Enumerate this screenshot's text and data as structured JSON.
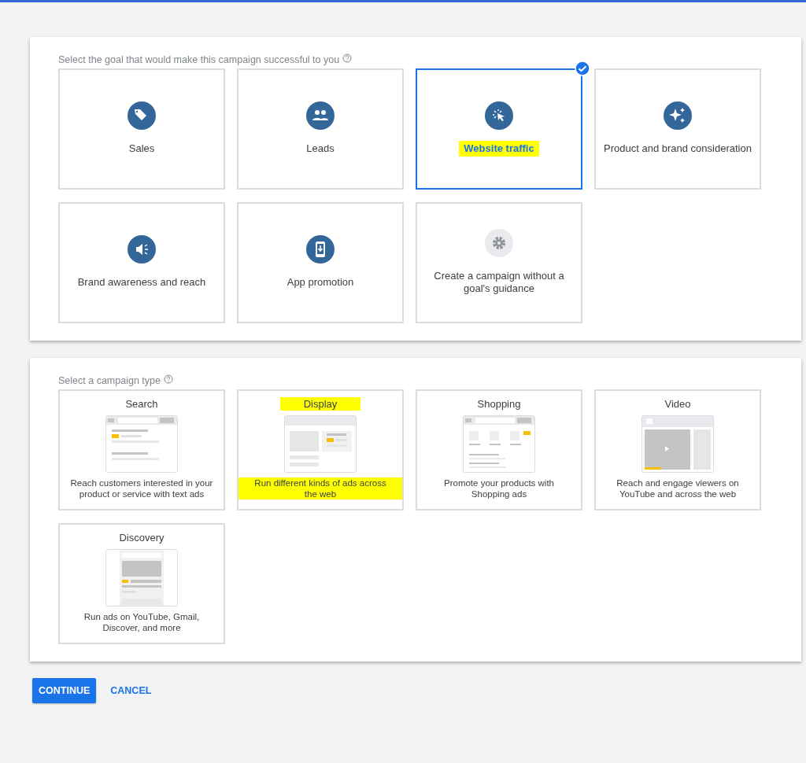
{
  "goal_section": {
    "prompt": "Select the goal that would make this campaign successful to you",
    "goals": [
      {
        "label": "Sales",
        "kind": "tag",
        "selected": false,
        "highlighted": false
      },
      {
        "label": "Leads",
        "kind": "people",
        "selected": false,
        "highlighted": false
      },
      {
        "label": "Website traffic",
        "kind": "cursor",
        "selected": true,
        "highlighted": true
      },
      {
        "label": "Product and brand consideration",
        "kind": "sparkle",
        "selected": false,
        "highlighted": false
      },
      {
        "label": "Brand awareness and reach",
        "kind": "megaphone",
        "selected": false,
        "highlighted": false
      },
      {
        "label": "App promotion",
        "kind": "phone",
        "selected": false,
        "highlighted": false
      },
      {
        "label": "Create a campaign without a goal's guidance",
        "kind": "gear",
        "selected": false,
        "highlighted": false
      }
    ]
  },
  "type_section": {
    "prompt": "Select a campaign type",
    "types": [
      {
        "title": "Search",
        "kind": "search",
        "description": "Reach customers interested in your product or service with text ads",
        "highlighted": false
      },
      {
        "title": "Display",
        "kind": "display",
        "description": "Run different kinds of ads across the web",
        "highlighted": true
      },
      {
        "title": "Shopping",
        "kind": "shopping",
        "description": "Promote your products with Shopping ads",
        "highlighted": false
      },
      {
        "title": "Video",
        "kind": "video",
        "description": "Reach and engage viewers on YouTube and across the web",
        "highlighted": false
      },
      {
        "title": "Discovery",
        "kind": "discovery",
        "description": "Run ads on YouTube, Gmail, Discover, and more",
        "highlighted": false
      }
    ]
  },
  "buttons": {
    "continue": "CONTINUE",
    "cancel": "CANCEL"
  }
}
